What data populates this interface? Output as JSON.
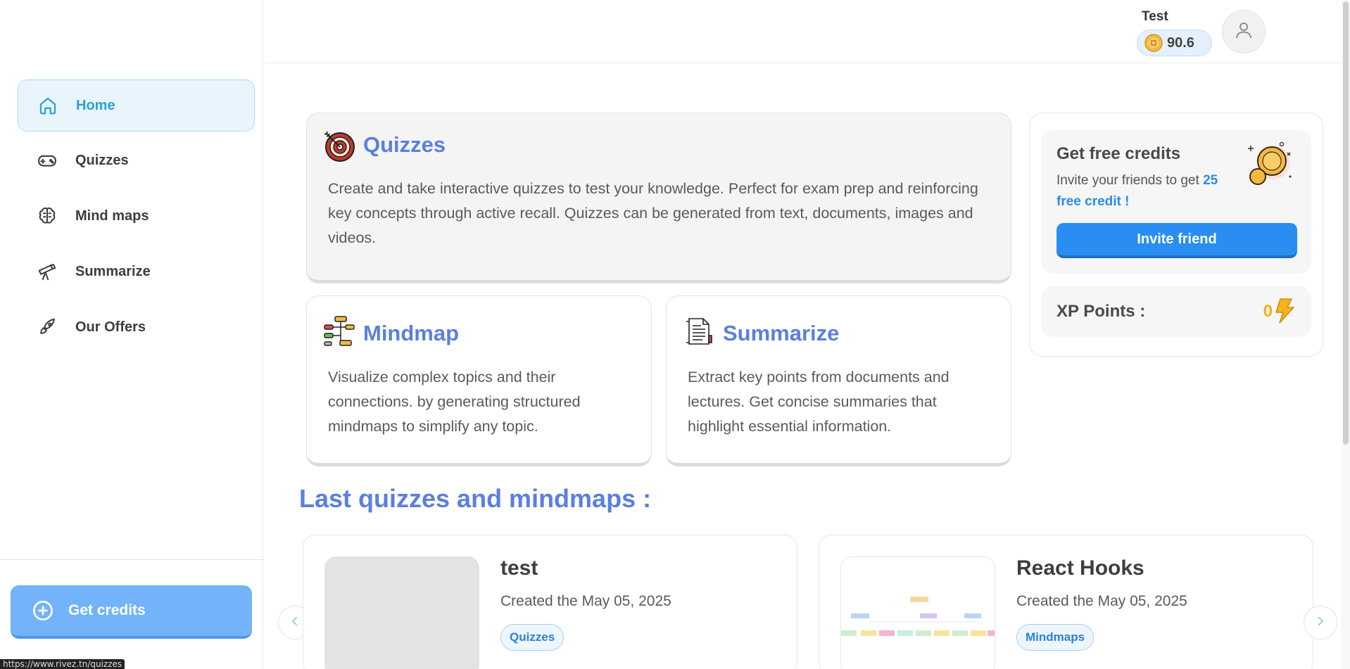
{
  "sidebar": {
    "items": [
      {
        "label": "Home",
        "icon": "home-icon"
      },
      {
        "label": "Quizzes",
        "icon": "gamepad-icon"
      },
      {
        "label": "Mind maps",
        "icon": "brain-icon"
      },
      {
        "label": "Summarize",
        "icon": "telescope-icon"
      },
      {
        "label": "Our Offers",
        "icon": "rocket-icon"
      }
    ],
    "get_credits_label": "Get credits",
    "status_url": "https://www.rivez.tn/quizzes"
  },
  "header": {
    "user_name": "Test",
    "credits": "90.6"
  },
  "features": {
    "quizzes": {
      "title": "Quizzes",
      "description": "Create and take interactive quizzes to test your knowledge. Perfect for exam prep and reinforcing key concepts through active recall. Quizzes can be generated from text, documents, images and videos."
    },
    "mindmap": {
      "title": "Mindmap",
      "description": "Visualize complex topics and their connections. by generating structured mindmaps to simplify any topic."
    },
    "summarize": {
      "title": "Summarize",
      "description": "Extract key points from documents and lectures. Get concise summaries that highlight essential information."
    }
  },
  "side_panel": {
    "free_credits_title": "Get free credits",
    "free_credits_text": "Invite your friends to get ",
    "free_credits_highlight": "25 free credit !",
    "invite_button": "Invite friend",
    "xp_label": "XP Points :",
    "xp_value": "0"
  },
  "last_section": {
    "title": "Last quizzes and mindmaps :",
    "items": [
      {
        "title": "test",
        "date": "Created the May 05, 2025",
        "tag": "Quizzes"
      },
      {
        "title": "React Hooks",
        "date": "Created the May 05, 2025",
        "tag": "Mindmaps"
      }
    ]
  },
  "colors": {
    "accent": "#5b7fe0",
    "active_nav": "#2aa3d8",
    "primary_button": "#2a8df2",
    "credits_button": "#72b3f9",
    "xp": "#f2b21b"
  }
}
